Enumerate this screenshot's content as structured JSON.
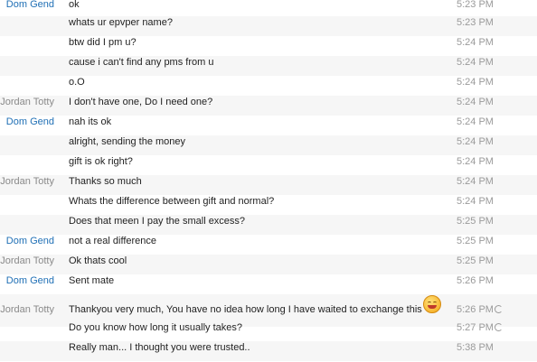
{
  "messages": [
    {
      "sender": "Dom Gend",
      "text": "ok",
      "time": "5:23 PM"
    },
    {
      "sender": "",
      "text": "whats ur epvper name?",
      "time": "5:23 PM"
    },
    {
      "sender": "",
      "text": "btw did I pm u?",
      "time": "5:24 PM"
    },
    {
      "sender": "",
      "text": "cause i can't find any pms from u",
      "time": "5:24 PM"
    },
    {
      "sender": "",
      "text": "o.O",
      "time": "5:24 PM"
    },
    {
      "sender": "Jordan Totty",
      "text": "I don't have one, Do I need one?",
      "time": "5:24 PM"
    },
    {
      "sender": "Dom Gend",
      "text": "nah its ok",
      "time": "5:24 PM"
    },
    {
      "sender": "",
      "text": "alright, sending the money",
      "time": "5:24 PM"
    },
    {
      "sender": "",
      "text": "gift is ok right?",
      "time": "5:24 PM"
    },
    {
      "sender": "Jordan Totty",
      "text": "Thanks so much",
      "time": "5:24 PM"
    },
    {
      "sender": "",
      "text": "Whats the difference between gift and normal?",
      "time": "5:24 PM"
    },
    {
      "sender": "",
      "text": "Does that meen I pay the small excess?",
      "time": "5:25 PM"
    },
    {
      "sender": "Dom Gend",
      "text": "not a real difference",
      "time": "5:25 PM"
    },
    {
      "sender": "Jordan Totty",
      "text": "Ok thats cool",
      "time": "5:25 PM"
    },
    {
      "sender": "Dom Gend",
      "text": "Sent mate",
      "time": "5:26 PM"
    },
    {
      "sender": "Jordan Totty",
      "text": "Thankyou very much, You have no idea how long I have waited to exchange this",
      "time": "5:26 PM"
    },
    {
      "sender": "",
      "text": "Do you know how long it usually takes?",
      "time": "5:27 PM"
    },
    {
      "sender": "",
      "text": "Really man... I thought you were trusted..",
      "time": "5:38 PM"
    }
  ],
  "icons": {
    "emoji": "grinning-emoji-icon",
    "pending": "pending-spinner-icon"
  }
}
